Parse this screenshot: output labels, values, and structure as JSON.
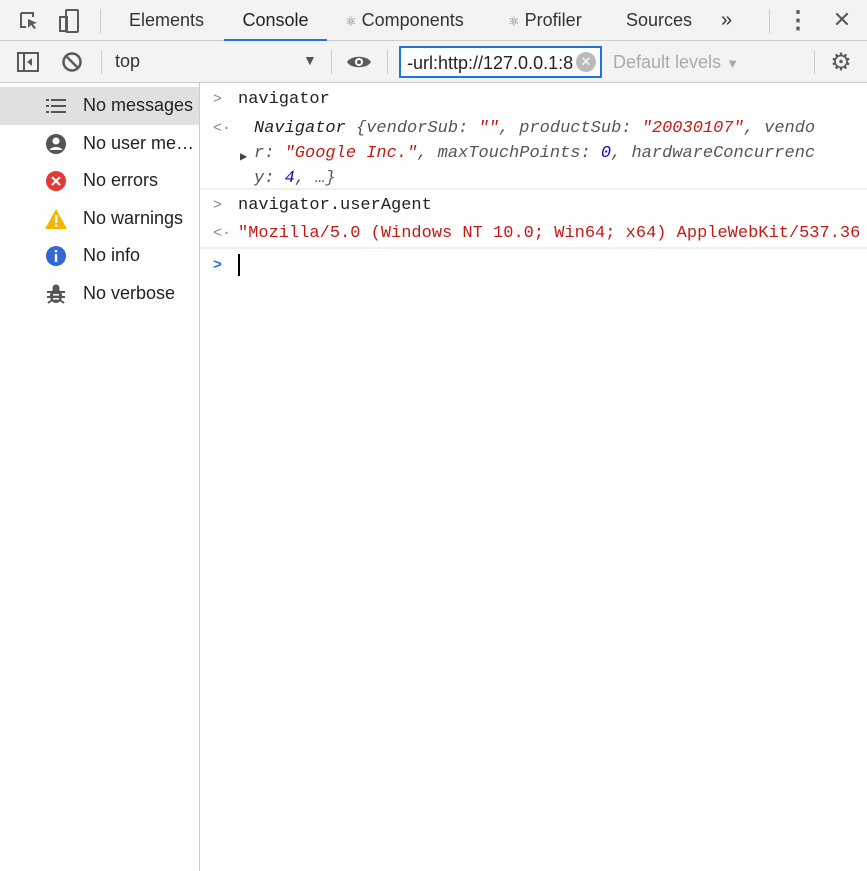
{
  "toolbar": {
    "tabs": [
      "Elements",
      "Console",
      "Components",
      "Profiler",
      "Sources"
    ],
    "active_tab": "Console",
    "more": "»",
    "menu": "⋮",
    "close": "✕"
  },
  "filterbar": {
    "context": "top",
    "filter_value": "-url:http://127.0.0.1:8",
    "levels": "Default levels"
  },
  "sidebar": {
    "items": [
      {
        "label": "No messages",
        "icon": "list-icon"
      },
      {
        "label": "No user messages",
        "icon": "user-icon"
      },
      {
        "label": "No errors",
        "icon": "error-icon"
      },
      {
        "label": "No warnings",
        "icon": "warning-icon"
      },
      {
        "label": "No info",
        "icon": "info-icon"
      },
      {
        "label": "No verbose",
        "icon": "bug-icon"
      }
    ]
  },
  "console": {
    "cmd1": "navigator",
    "out1": {
      "name": "Navigator",
      "l1a": " {vendorSub: ",
      "s1": "\"\"",
      "l1b": ", productSub: ",
      "s2": "\"20030107\"",
      "l1c": ", vendo",
      "l2a": "r: ",
      "s3": "\"Google Inc.\"",
      "l2b": ", maxTouchPoints: ",
      "n1": "0",
      "l2c": ", hardwareConcurrenc",
      "l3a": "y: ",
      "n2": "4",
      "l3b": ", …}"
    },
    "cmd2": "navigator.userAgent",
    "out2": "\"Mozilla/5.0 (Windows NT 10.0; Win64; x64) AppleWebKit/537.36"
  },
  "colors": {
    "accent": "#1a73e8",
    "string": "#c41a16",
    "number": "#1c00cf"
  }
}
